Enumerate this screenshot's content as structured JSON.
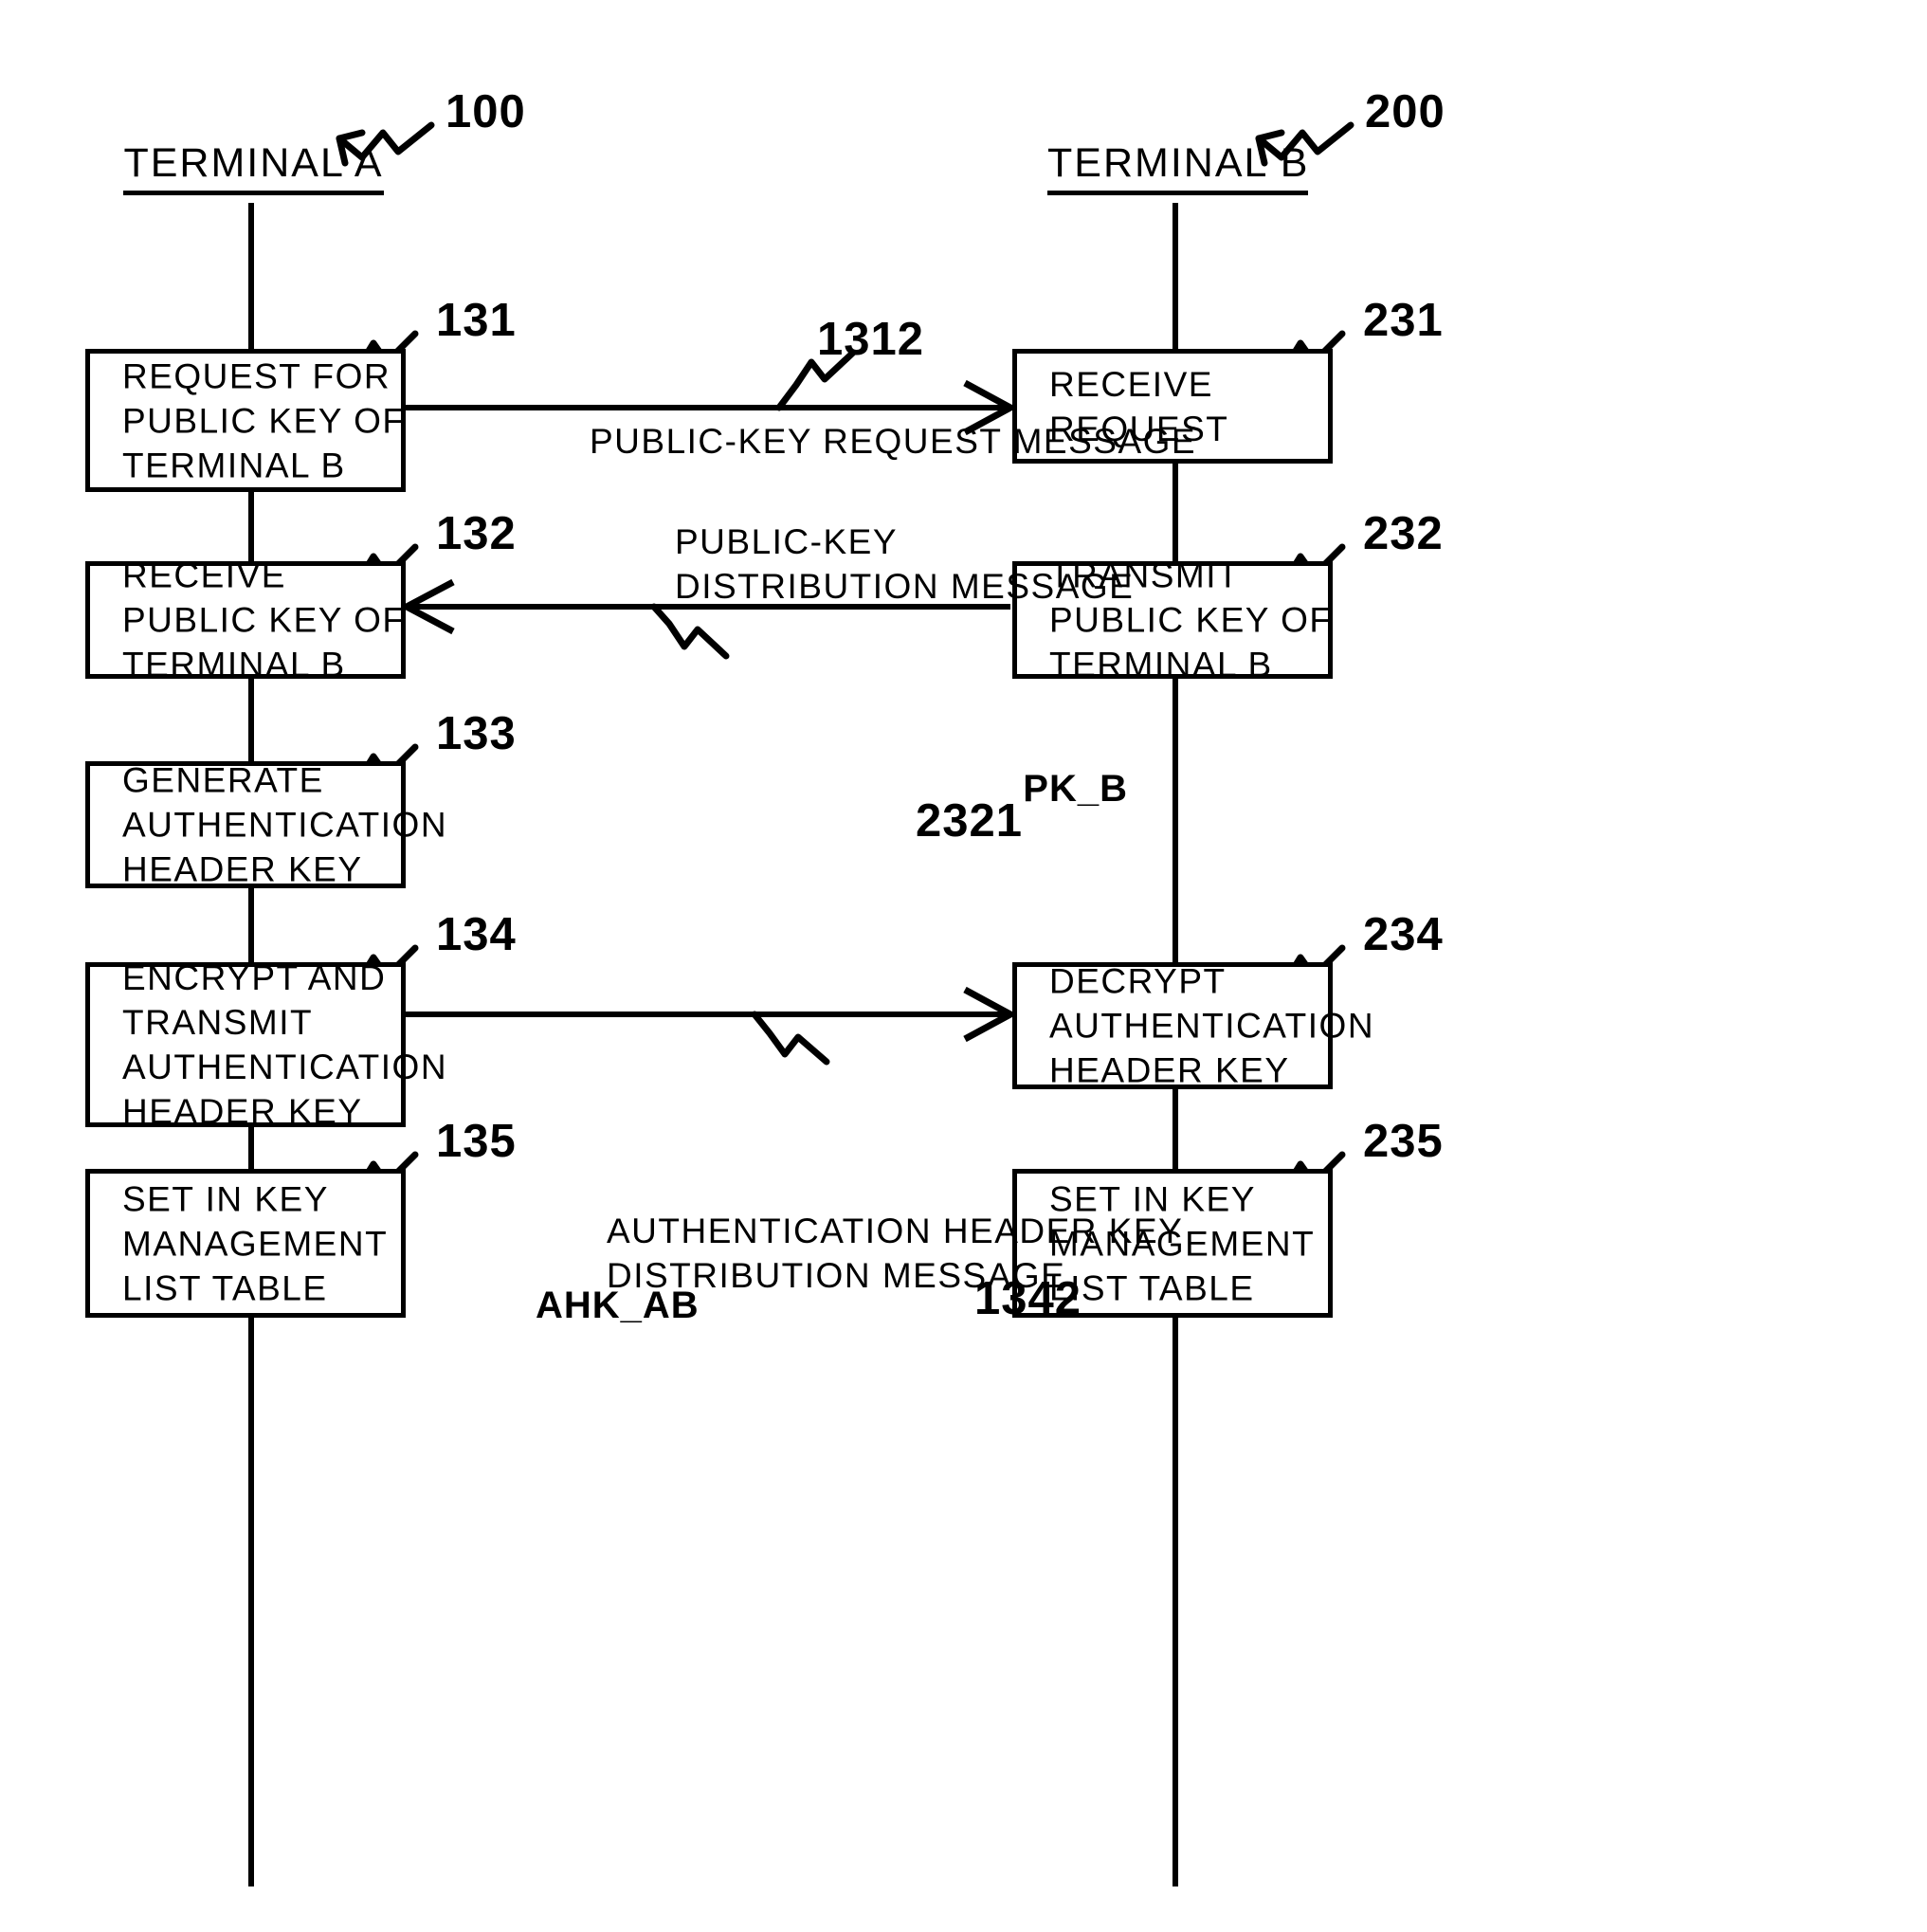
{
  "figure": {
    "type": "sequence-flow-diagram",
    "columns": [
      {
        "id": "A",
        "title": "TERMINAL A",
        "ref": "100"
      },
      {
        "id": "B",
        "title": "TERMINAL B",
        "ref": "200"
      }
    ],
    "left_steps": [
      {
        "ref": "131",
        "lines": "REQUEST FOR\nPUBLIC KEY OF\nTERMINAL B"
      },
      {
        "ref": "132",
        "lines": "RECEIVE\nPUBLIC KEY OF\nTERMINAL B"
      },
      {
        "ref": "133",
        "lines": "GENERATE\nAUTHENTICATION\nHEADER KEY"
      },
      {
        "ref": "134",
        "lines": "ENCRYPT AND\nTRANSMIT\nAUTHENTICATION\nHEADER KEY"
      },
      {
        "ref": "135",
        "lines": "SET IN KEY\nMANAGEMENT\nLIST TABLE"
      }
    ],
    "right_steps": [
      {
        "ref": "231",
        "lines": "RECEIVE\nREQUEST"
      },
      {
        "ref": "232",
        "lines": "TRANSMIT\nPUBLIC KEY OF\nTERMINAL B"
      },
      {
        "ref": "234",
        "lines": "DECRYPT\nAUTHENTICATION\nHEADER KEY"
      },
      {
        "ref": "235",
        "lines": "SET IN KEY\nMANAGEMENT\nLIST TABLE"
      }
    ],
    "messages": [
      {
        "ref": "1312",
        "direction": "left-to-right",
        "label": "PUBLIC-KEY REQUEST MESSAGE",
        "payload": ""
      },
      {
        "ref": "2321",
        "direction": "right-to-left",
        "label": "PUBLIC-KEY\nDISTRIBUTION MESSAGE",
        "payload": "PK_B"
      },
      {
        "ref": "1342",
        "direction": "left-to-right",
        "label": "AUTHENTICATION HEADER KEY\nDISTRIBUTION MESSAGE",
        "payload": "AHK_AB"
      }
    ],
    "colors": {
      "ink": "#000000",
      "paper": "#ffffff"
    }
  }
}
